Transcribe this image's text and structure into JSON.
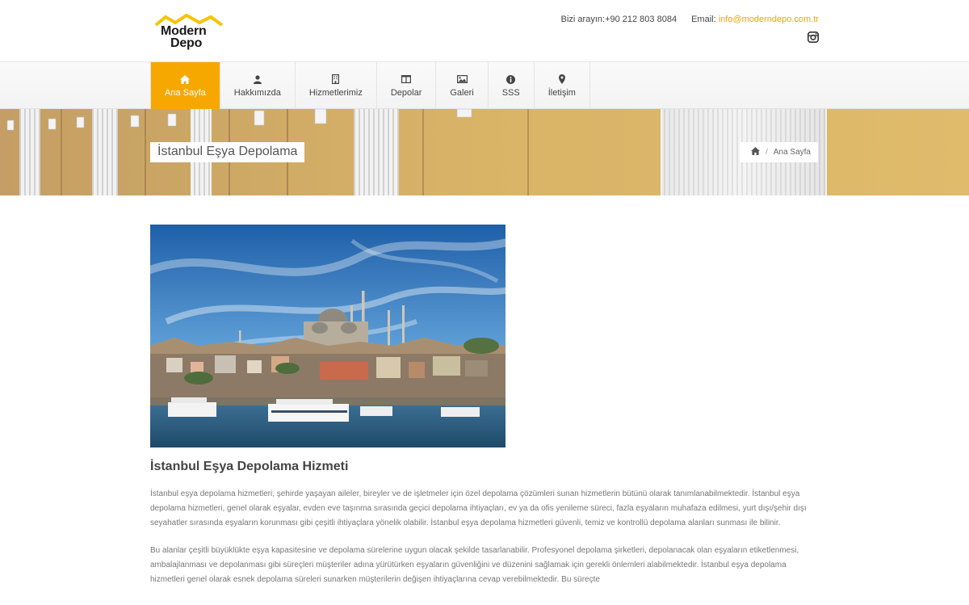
{
  "logo": {
    "line1": "Modern",
    "line2": "Depo"
  },
  "contact": {
    "phone_label": "Bizi arayın:",
    "phone": "+90 212 803 8084",
    "email_label": "Email:",
    "email": "info@moderndepo.com.tr"
  },
  "social": {
    "instagram_icon": "instagram-icon"
  },
  "nav": {
    "items": [
      {
        "label": "Ana Sayfa",
        "icon": "home-icon",
        "active": true
      },
      {
        "label": "Hakkımızda",
        "icon": "user-icon",
        "active": false
      },
      {
        "label": "Hizmetlerimiz",
        "icon": "building-icon",
        "active": false
      },
      {
        "label": "Depolar",
        "icon": "columns-icon",
        "active": false
      },
      {
        "label": "Galeri",
        "icon": "image-icon",
        "active": false
      },
      {
        "label": "SSS",
        "icon": "info-icon",
        "active": false
      },
      {
        "label": "İletişim",
        "icon": "map-marker-icon",
        "active": false
      }
    ]
  },
  "banner": {
    "title": "İstanbul Eşya Depolama",
    "breadcrumb_home_icon": "home-icon",
    "breadcrumb_separator": "/",
    "breadcrumb_current": "Ana Sayfa"
  },
  "article": {
    "title": "İstanbul Eşya Depolama Hizmeti",
    "paragraph1": "İstanbul eşya depolama hizmetleri, şehirde yaşayan aileler, bireyler ve de işletmeler için özel depolama çözümleri sunan hizmetlerin bütünü olarak tanımlanabilmektedir. İstanbul eşya depolama hizmetleri, genel olarak eşyalar, evden eve taşınma sırasında geçici depolama ihtiyaçları, ev ya da ofis yenileme süreci, fazla eşyaların muhafaza edilmesi, yurt dışı/şehir dışı seyahatler sırasında eşyaların korunması gibi çeşitli ihtiyaçlara yönelik olabilir. İstanbul eşya depolama hizmetleri güvenli, temiz ve kontrollü depolama alanları sunması ile bilinir.",
    "paragraph2": "Bu alanlar çeşitli büyüklükte eşya kapasitesine ve depolama sürelerine uygun olacak şekilde tasarlanabilir. Profesyonel depolama şirketleri, depolanacak olan eşyaların etiketlenmesi, ambalajlanması ve depolanması gibi süreçleri müşteriler adına yürütürken eşyaların güvenliğini ve düzenini sağlamak için gerekli önlemleri alabilmektedir. İstanbul eşya depolama hizmetleri genel olarak esnek depolama süreleri sunarken müşterilerin değişen ihtiyaçlarına cevap verebilmektedir. Bu süreçte"
  },
  "colors": {
    "accent": "#f7a800",
    "email": "#f0a500"
  }
}
